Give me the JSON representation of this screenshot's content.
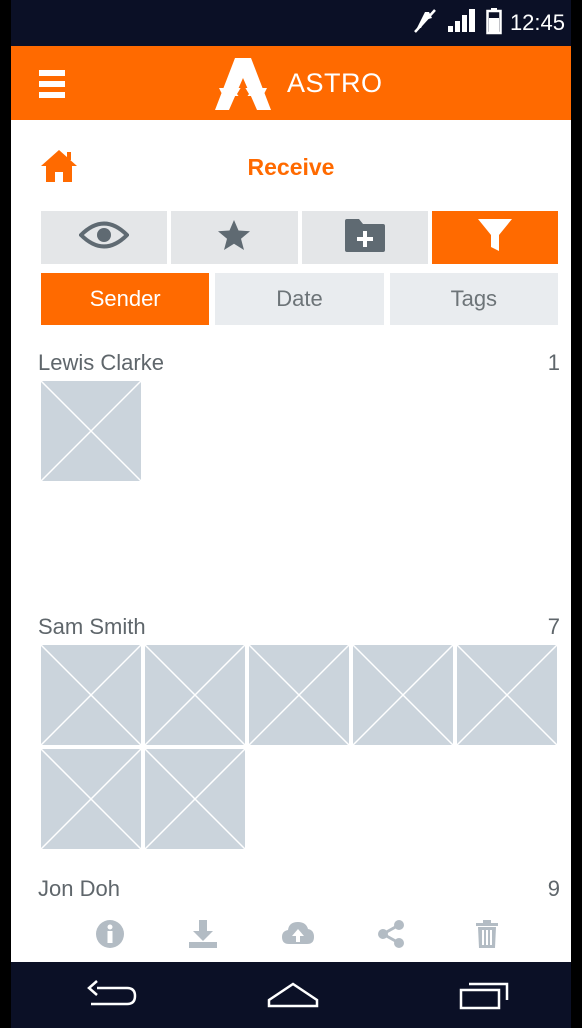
{
  "status_bar": {
    "time": "12:45",
    "icons": [
      "mute-icon",
      "signal-icon",
      "battery-icon"
    ]
  },
  "app_bar": {
    "title": "ASTRO",
    "icons": [
      "menu-icon",
      "astro-logo"
    ]
  },
  "page": {
    "title": "Receive",
    "home_icon": "home-icon"
  },
  "toolbar": {
    "buttons": [
      {
        "icon": "eye-icon",
        "active": false
      },
      {
        "icon": "star-icon",
        "active": false
      },
      {
        "icon": "folder-add-icon",
        "active": false
      },
      {
        "icon": "filter-icon",
        "active": true
      }
    ]
  },
  "sort_tabs": [
    {
      "label": "Sender",
      "active": true
    },
    {
      "label": "Date",
      "active": false
    },
    {
      "label": "Tags",
      "active": false
    }
  ],
  "groups": [
    {
      "name": "Lewis Clarke",
      "count": "1"
    },
    {
      "name": "Sam Smith",
      "count": "7"
    },
    {
      "name": "Jon Doh",
      "count": "9"
    }
  ],
  "bottom_actions": [
    "info-icon",
    "download-icon",
    "upload-icon",
    "share-icon",
    "delete-icon"
  ],
  "nav_bar": [
    "back-icon",
    "home-nav-icon",
    "recents-icon"
  ],
  "colors": {
    "accent": "#ff6a00",
    "system_bar": "#0b1026",
    "placeholder": "#cbd4dc",
    "tab_inactive": "#e9ecef",
    "icon_gray": "#b3bcc4"
  }
}
